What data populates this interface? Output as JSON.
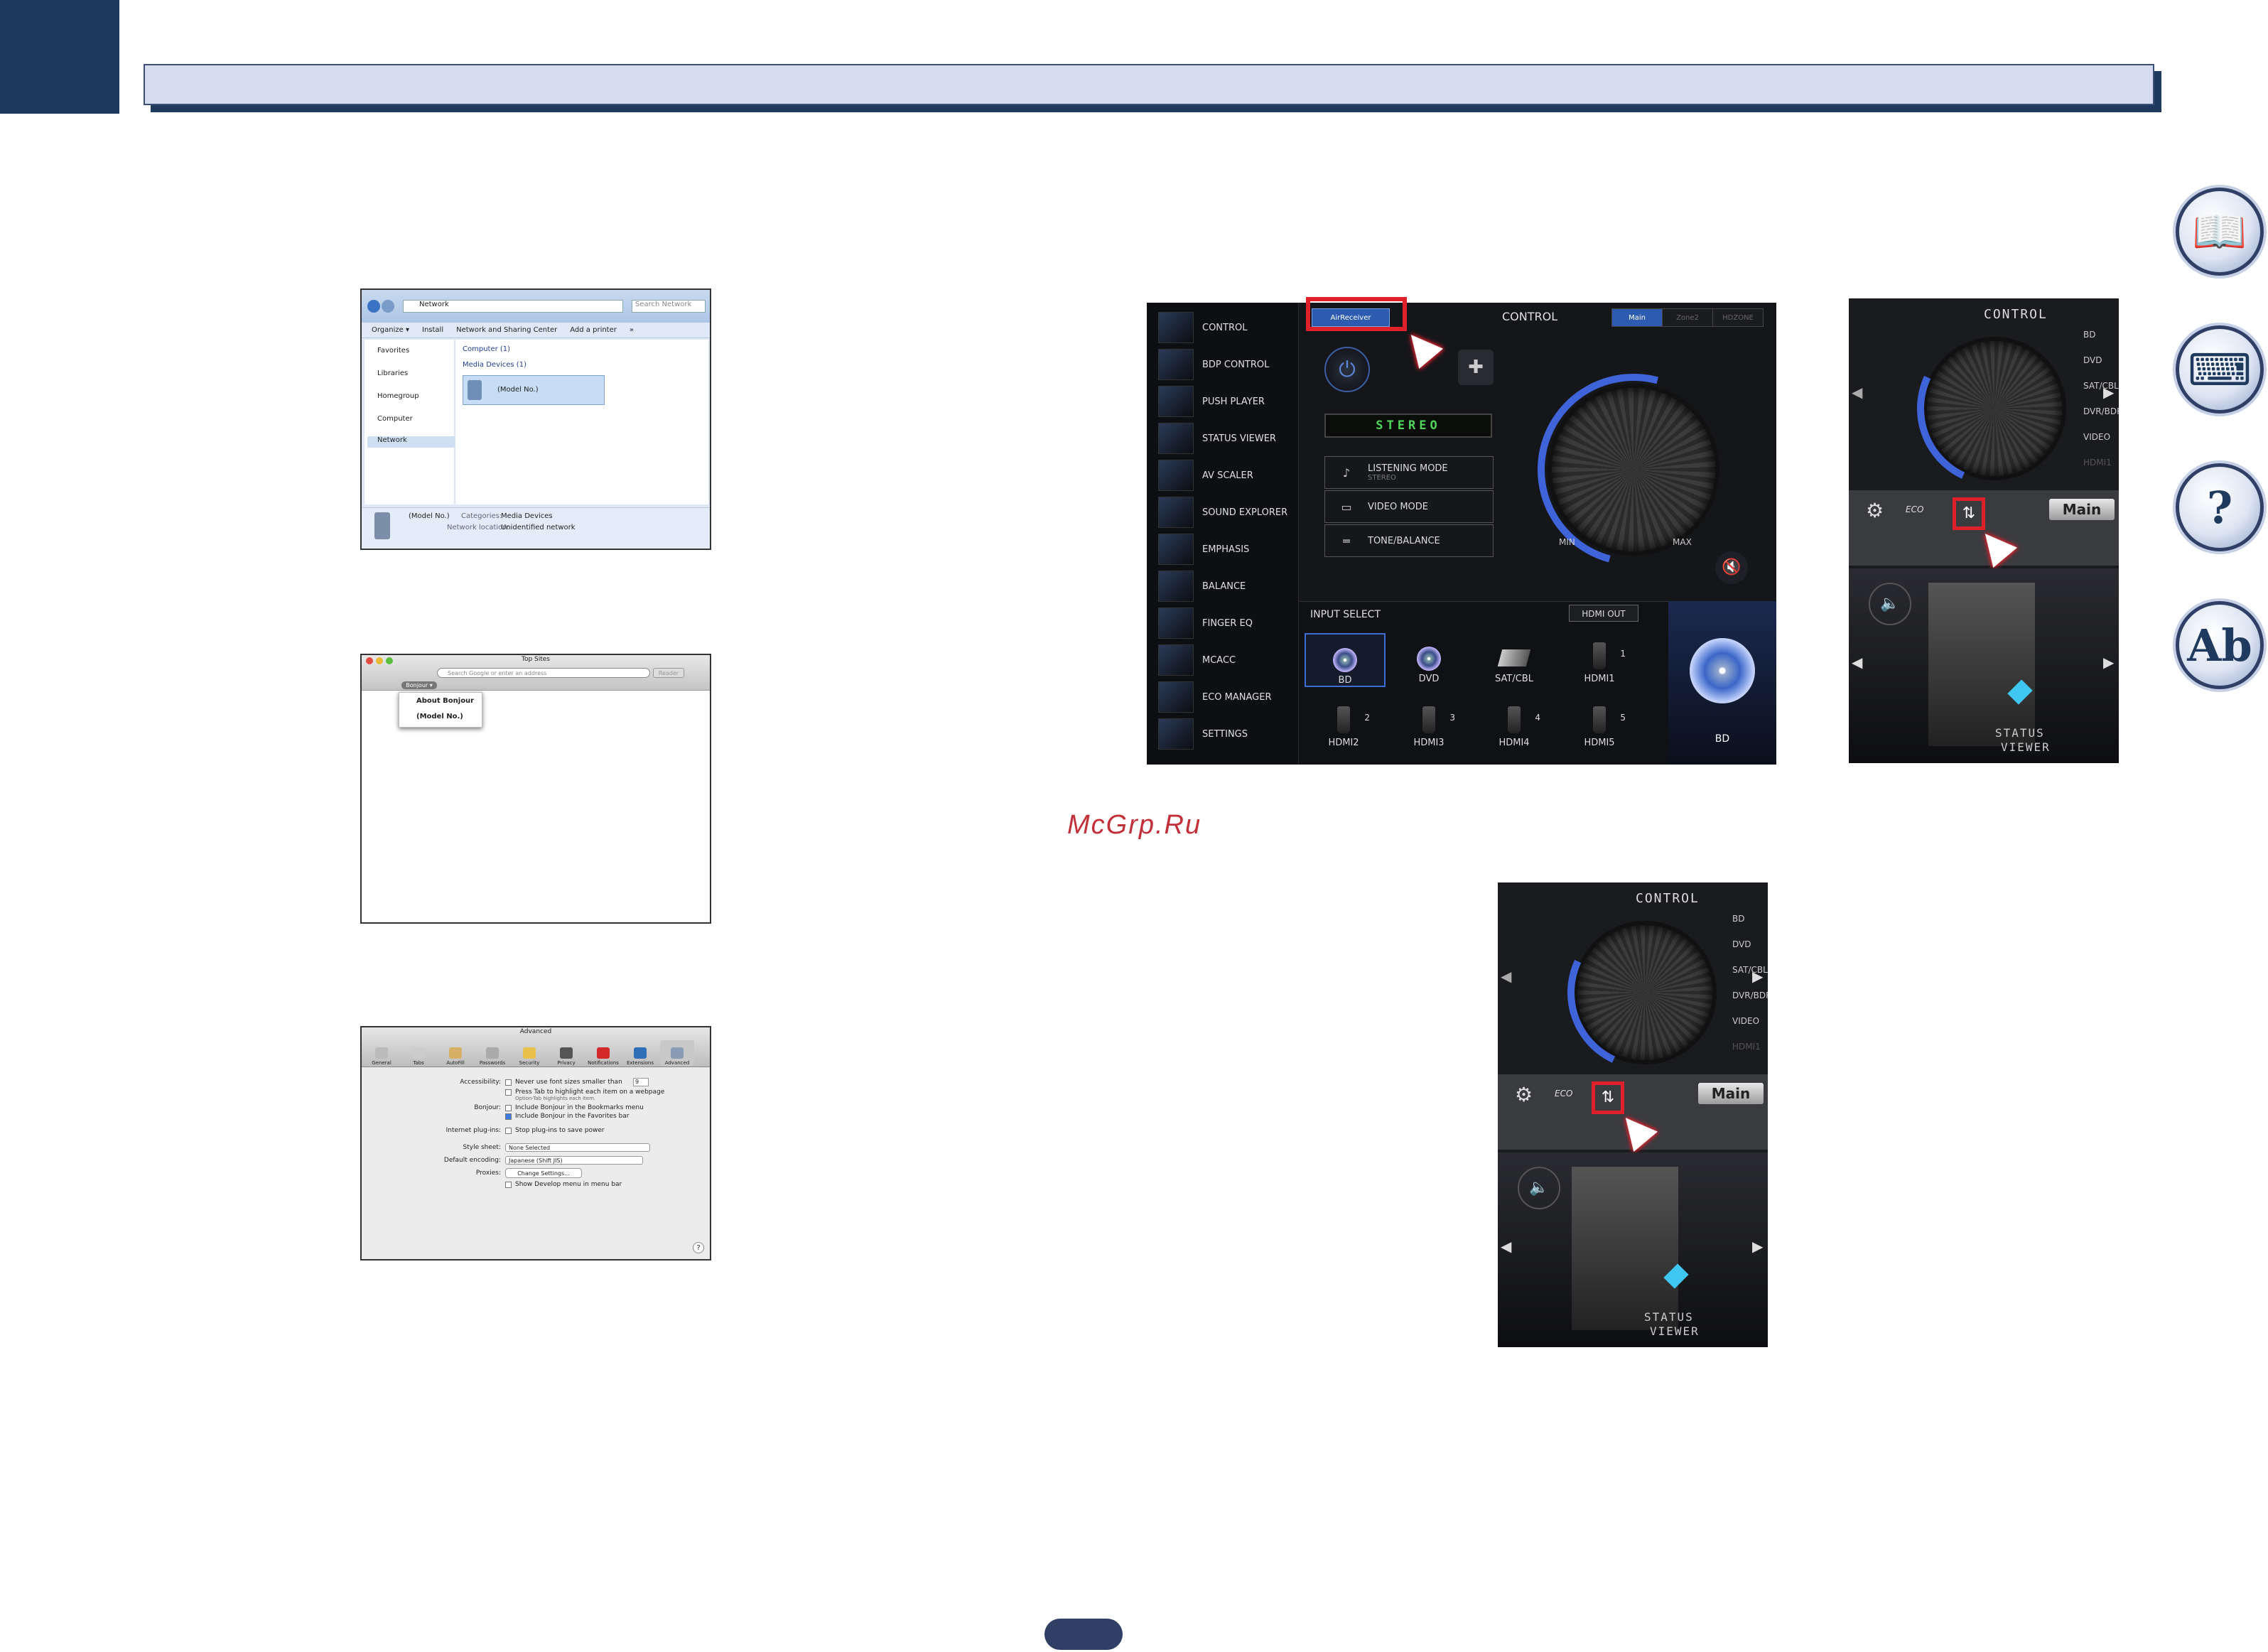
{
  "page": {
    "watermark": "McGrp.Ru"
  },
  "side_icons": [
    {
      "name": "book-icon"
    },
    {
      "name": "remote-icon"
    },
    {
      "name": "help-icon"
    },
    {
      "name": "abc-icon"
    }
  ],
  "explorer": {
    "address": "Network",
    "search_placeholder": "Search Network",
    "toolbar": [
      "Organize ▾",
      "Install",
      "Network and Sharing Center",
      "Add a printer",
      "»"
    ],
    "nav": [
      "Favorites",
      "Libraries",
      "Homegroup",
      "Computer",
      "Network"
    ],
    "groups": [
      {
        "label": "Computer (1)"
      },
      {
        "label": "Media Devices (1)"
      }
    ],
    "device": "(Model No.)",
    "details": {
      "name": "(Model No.)",
      "categories_label": "Categories:",
      "categories": "Media Devices",
      "location_label": "Network location:",
      "location": "Unidentified network"
    }
  },
  "safari": {
    "title": "Top Sites",
    "url_placeholder": "Search Google or enter an address",
    "reader": "Reader",
    "bonjour_button": "Bonjour ▾",
    "menu": [
      "About Bonjour",
      "(Model No.)"
    ]
  },
  "advanced": {
    "title": "Advanced",
    "tabs": [
      "General",
      "Tabs",
      "AutoFill",
      "Passwords",
      "Security",
      "Privacy",
      "Notifications",
      "Extensions",
      "Advanced"
    ],
    "rows": [
      {
        "label": "Accessibility:",
        "text": "Never use font sizes smaller than",
        "value": "9"
      },
      {
        "label": "",
        "text": "Press Tab to highlight each item on a webpage",
        "sub": "Option-Tab highlights each item."
      },
      {
        "label": "Bonjour:",
        "text": "Include Bonjour in the Bookmarks menu"
      },
      {
        "label": "",
        "text": "Include Bonjour in the Favorites bar",
        "checked": true
      },
      {
        "label": "Internet plug-ins:",
        "text": "Stop plug-ins to save power"
      },
      {
        "label": "Style sheet:",
        "select": "None Selected"
      },
      {
        "label": "Default encoding:",
        "select": "Japanese (Shift JIS)"
      },
      {
        "label": "Proxies:",
        "button": "Change Settings..."
      },
      {
        "label": "",
        "text": "Show Develop menu in menu bar"
      }
    ],
    "help": "?"
  },
  "control": {
    "airplay_button": "AirReceiver",
    "title": "CONTROL",
    "zones": [
      "Main",
      "Zone2",
      "HDZONE"
    ],
    "menu": [
      "CONTROL",
      "BDP CONTROL",
      "PUSH PLAYER",
      "STATUS VIEWER",
      "AV SCALER",
      "SOUND EXPLORER",
      "EMPHASIS",
      "BALANCE",
      "FINGER EQ",
      "MCACC",
      "ECO MANAGER",
      "SETTINGS"
    ],
    "display": "STEREO",
    "modes": [
      {
        "icon": "♪",
        "label": "LISTENING MODE",
        "sub": "STEREO"
      },
      {
        "icon": "▭",
        "label": "VIDEO MODE",
        "sub": ""
      },
      {
        "icon": "═",
        "label": "TONE/BALANCE",
        "sub": ""
      }
    ],
    "min": "MIN",
    "max": "MAX",
    "input_select": "INPUT SELECT",
    "hdmi_out": "HDMI OUT",
    "sources": [
      "BD",
      "DVD",
      "SAT/CBL",
      "HDMI1",
      "HDMI2",
      "HDMI3",
      "HDMI4",
      "HDMI5"
    ],
    "source_nums": [
      "",
      "",
      "",
      "1",
      "2",
      "3",
      "4",
      "5"
    ],
    "current": "BD"
  },
  "phone1": {
    "title": "CONTROL",
    "list": [
      "BD",
      "DVD",
      "SAT/CBL",
      "DVR/BDR",
      "VIDEO",
      "HDMI1"
    ],
    "main": "Main",
    "eco": "ECO",
    "status": [
      "STATUS",
      "VIEWER"
    ]
  },
  "phone2": {
    "title": "CONTROL",
    "list": [
      "BD",
      "DVD",
      "SAT/CBL",
      "DVR/BDR",
      "VIDEO",
      "HDMI1"
    ],
    "main": "Main",
    "eco": "ECO",
    "status": [
      "STATUS",
      "VIEWER"
    ]
  }
}
